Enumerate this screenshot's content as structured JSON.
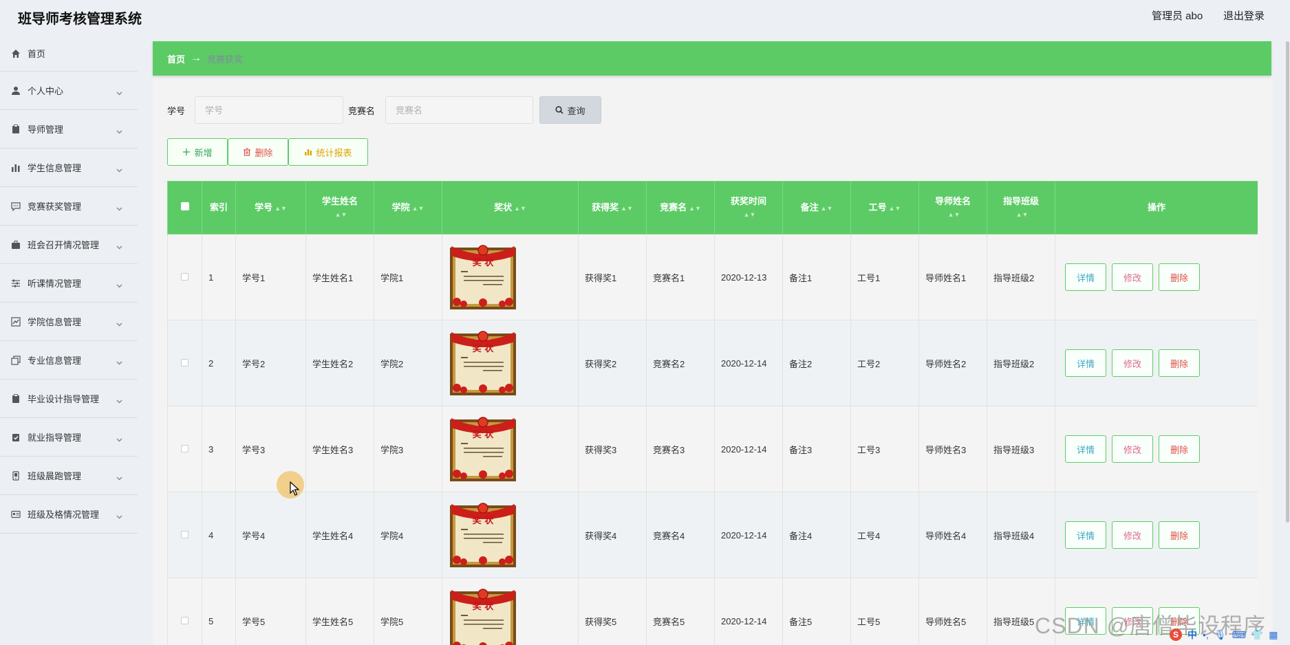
{
  "header": {
    "app_title": "班导师考核管理系统",
    "user_label": "管理员 abo",
    "logout_label": "退出登录"
  },
  "sidebar": {
    "items": [
      {
        "label": "首页",
        "icon": "home-icon",
        "has_submenu": false
      },
      {
        "label": "个人中心",
        "icon": "user-icon",
        "has_submenu": true
      },
      {
        "label": "导师管理",
        "icon": "clipboard-icon",
        "has_submenu": true
      },
      {
        "label": "学生信息管理",
        "icon": "bar-chart-icon",
        "has_submenu": true
      },
      {
        "label": "竞赛获奖管理",
        "icon": "message-icon",
        "has_submenu": true
      },
      {
        "label": "班会召开情况管理",
        "icon": "briefcase-icon",
        "has_submenu": true
      },
      {
        "label": "听课情况管理",
        "icon": "sliders-icon",
        "has_submenu": true
      },
      {
        "label": "学院信息管理",
        "icon": "trend-chart-icon",
        "has_submenu": true
      },
      {
        "label": "专业信息管理",
        "icon": "copy-icon",
        "has_submenu": true
      },
      {
        "label": "毕业设计指导管理",
        "icon": "clipboard-icon",
        "has_submenu": true
      },
      {
        "label": "就业指导管理",
        "icon": "clipboard-check-icon",
        "has_submenu": true
      },
      {
        "label": "班级晨跑管理",
        "icon": "device-icon",
        "has_submenu": true
      },
      {
        "label": "班级及格情况管理",
        "icon": "id-card-icon",
        "has_submenu": true
      }
    ]
  },
  "breadcrumb": {
    "home": "首页",
    "separator": "→",
    "current": "竞赛获奖"
  },
  "search": {
    "field1_label": "学号",
    "field1_placeholder": "学号",
    "field2_label": "竞赛名",
    "field2_placeholder": "竞赛名",
    "query_label": "查询"
  },
  "actions": {
    "add_label": "新增",
    "delete_label": "删除",
    "report_label": "统计报表"
  },
  "table": {
    "columns": [
      "索引",
      "学号",
      "学生姓名",
      "学院",
      "奖状",
      "获得奖",
      "竞赛名",
      "获奖时间",
      "备注",
      "工号",
      "导师姓名",
      "指导班级",
      "操作"
    ],
    "rows": [
      {
        "index": "1",
        "student_id": "学号1",
        "student_name": "学生姓名1",
        "college": "学院1",
        "award": "获得奖1",
        "competition": "竞赛名1",
        "date": "2020-12-13",
        "remark": "备注1",
        "staff_id": "工号1",
        "tutor": "导师姓名1",
        "class": "指导班级2"
      },
      {
        "index": "2",
        "student_id": "学号2",
        "student_name": "学生姓名2",
        "college": "学院2",
        "award": "获得奖2",
        "competition": "竞赛名2",
        "date": "2020-12-14",
        "remark": "备注2",
        "staff_id": "工号2",
        "tutor": "导师姓名2",
        "class": "指导班级2"
      },
      {
        "index": "3",
        "student_id": "学号3",
        "student_name": "学生姓名3",
        "college": "学院3",
        "award": "获得奖3",
        "competition": "竞赛名3",
        "date": "2020-12-14",
        "remark": "备注3",
        "staff_id": "工号3",
        "tutor": "导师姓名3",
        "class": "指导班级3"
      },
      {
        "index": "4",
        "student_id": "学号4",
        "student_name": "学生姓名4",
        "college": "学院4",
        "award": "获得奖4",
        "competition": "竞赛名4",
        "date": "2020-12-14",
        "remark": "备注4",
        "staff_id": "工号4",
        "tutor": "导师姓名4",
        "class": "指导班级4"
      },
      {
        "index": "5",
        "student_id": "学号5",
        "student_name": "学生姓名5",
        "college": "学院5",
        "award": "获得奖5",
        "competition": "竞赛名5",
        "date": "2020-12-14",
        "remark": "备注5",
        "staff_id": "工号5",
        "tutor": "导师姓名5",
        "class": "指导班级5"
      }
    ],
    "row_actions": {
      "detail": "详情",
      "edit": "修改",
      "delete": "删除"
    },
    "certificate_text": "奖 状"
  },
  "watermark": "CSDN @唐僧毕设程序",
  "ime": {
    "lang": "中"
  },
  "colors": {
    "primary_green": "#5ccb66",
    "detail_text": "#3aa7c4",
    "edit_text": "#e06a8a",
    "delete_text": "#e0504a",
    "report_text": "#e0a400",
    "breadcrumb_current": "#7e8b9a"
  }
}
